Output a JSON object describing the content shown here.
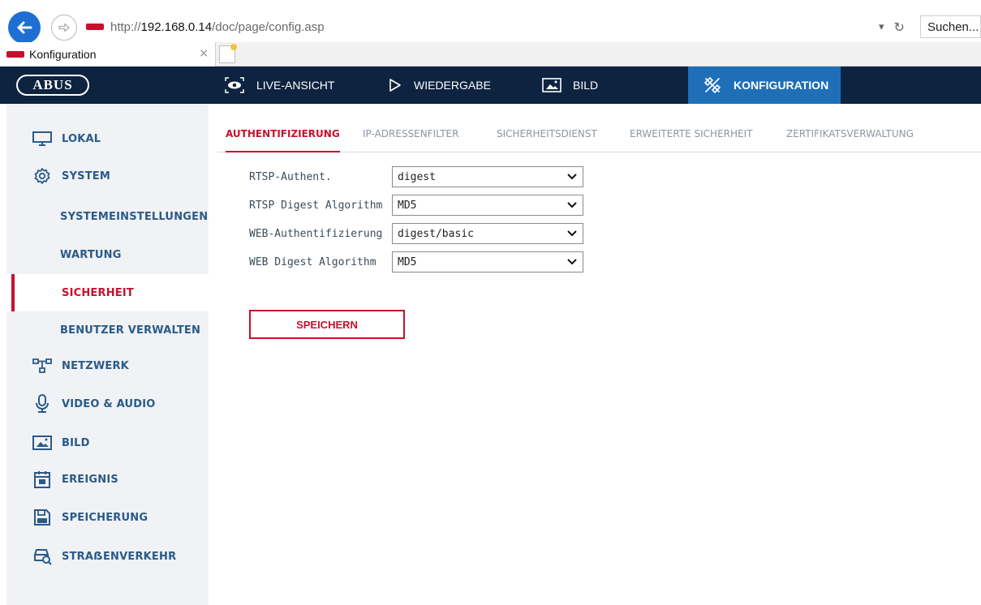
{
  "browser": {
    "url_prefix": "http://",
    "url_host": "192.168.0.14",
    "url_path": "/doc/page/config.asp",
    "refresh_symbol": "↻",
    "dropdown_symbol": "▾",
    "search_placeholder": "Suchen...",
    "tab_title": "Konfiguration",
    "tab_close": "×"
  },
  "app": {
    "logo": "ABUS",
    "nav": [
      {
        "label": "LIVE-ANSICHT",
        "icon": "eye-icon"
      },
      {
        "label": "WIEDERGABE",
        "icon": "play-icon"
      },
      {
        "label": "BILD",
        "icon": "image-icon"
      },
      {
        "label": "KONFIGURATION",
        "icon": "tools-icon",
        "active": true
      }
    ],
    "colors": {
      "header_bg": "#0e2340",
      "active_nav": "#1f6fb8",
      "accent": "#c8102e",
      "sidebar_text": "#2a5a8a"
    }
  },
  "sidebar": {
    "items": [
      {
        "label": "LOKAL",
        "icon": "monitor-icon"
      },
      {
        "label": "SYSTEM",
        "icon": "gear-icon"
      },
      {
        "label": "SYSTEMEINSTELLUNGEN"
      },
      {
        "label": "WARTUNG"
      },
      {
        "label": "SICHERHEIT",
        "active": true
      },
      {
        "label": "BENUTZER VERWALTEN"
      },
      {
        "label": "NETZWERK",
        "icon": "network-icon"
      },
      {
        "label": "VIDEO & AUDIO",
        "icon": "microphone-icon"
      },
      {
        "label": "BILD",
        "icon": "image-icon"
      },
      {
        "label": "EREIGNIS",
        "icon": "calendar-icon"
      },
      {
        "label": "SPEICHERUNG",
        "icon": "save-icon"
      },
      {
        "label": "STRAẞENVERKEHR",
        "icon": "car-search-icon"
      }
    ]
  },
  "subtabs": [
    {
      "label": "AUTHENTIFIZIERUNG",
      "active": true
    },
    {
      "label": "IP-ADRESSENFILTER"
    },
    {
      "label": "SICHERHEITSDIENST"
    },
    {
      "label": "ERWEITERTE SICHERHEIT"
    },
    {
      "label": "ZERTIFIKATSVERWALTUNG"
    }
  ],
  "form": {
    "fields": [
      {
        "label": "RTSP-Authent.",
        "value": "digest"
      },
      {
        "label": "RTSP Digest Algorithm",
        "value": "MD5"
      },
      {
        "label": "WEB-Authentifizierung",
        "value": "digest/basic"
      },
      {
        "label": "WEB Digest Algorithm",
        "value": "MD5"
      }
    ],
    "save_label": "SPEICHERN"
  }
}
